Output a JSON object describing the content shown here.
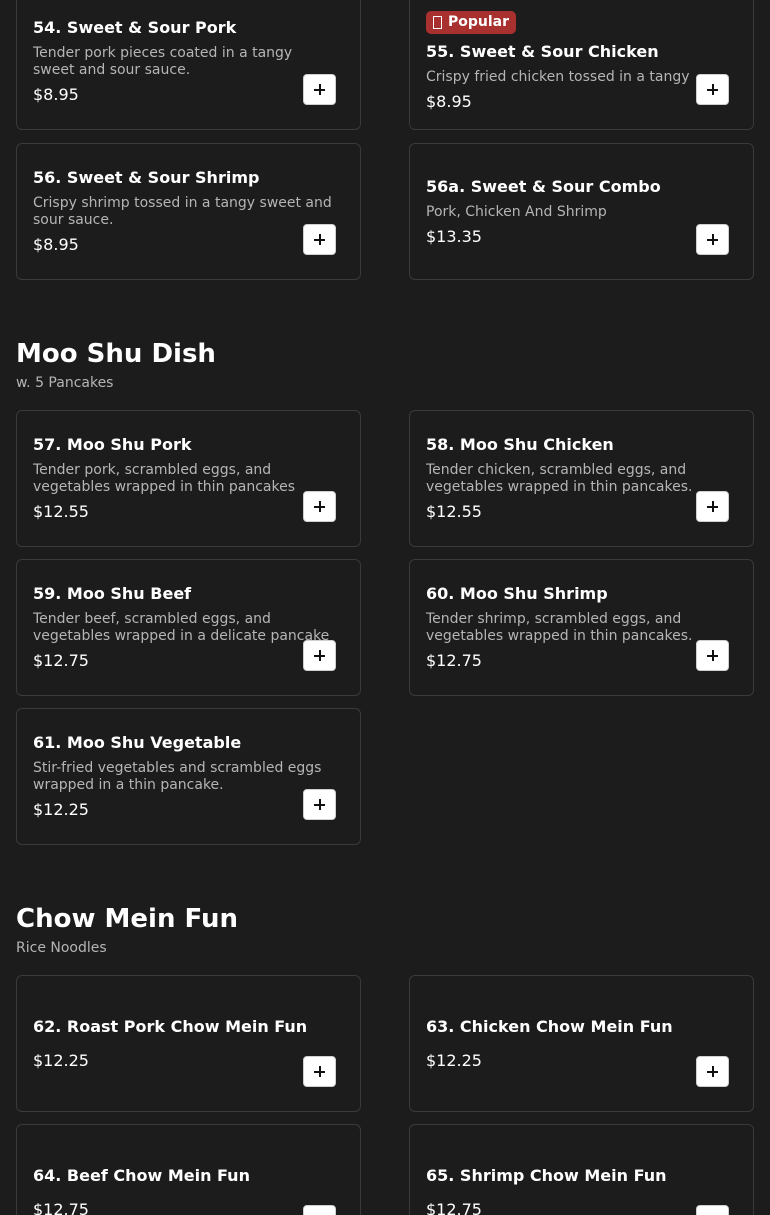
{
  "sweet_sour": {
    "items": [
      {
        "name": "54. Sweet & Sour Pork",
        "description": "Tender pork pieces coated in a tangy sweet and sour sauce.",
        "price": "$8.95"
      },
      {
        "badge": "Popular",
        "name": "55. Sweet & Sour Chicken",
        "description": "Crispy fried chicken tossed in a tangy sweet.",
        "price": "$8.95"
      },
      {
        "name": "56. Sweet & Sour Shrimp",
        "description": "Crispy shrimp tossed in a tangy sweet and sour sauce.",
        "price": "$8.95"
      },
      {
        "name": "56a. Sweet & Sour Combo",
        "description": "Pork, Chicken And Shrimp",
        "price": "$13.35"
      }
    ]
  },
  "moo_shu": {
    "title": "Moo Shu Dish",
    "subtitle": "w. 5 Pancakes",
    "items": [
      {
        "name": "57. Moo Shu Pork",
        "description": "Tender pork, scrambled eggs, and vegetables wrapped in thin pancakes",
        "price": "$12.55"
      },
      {
        "name": "58. Moo Shu Chicken",
        "description": "Tender chicken, scrambled eggs, and vegetables wrapped in thin pancakes.",
        "price": "$12.55"
      },
      {
        "name": "59. Moo Shu Beef",
        "description": "Tender beef, scrambled eggs, and vegetables wrapped in a delicate pancake",
        "price": "$12.75"
      },
      {
        "name": "60. Moo Shu Shrimp",
        "description": "Tender shrimp, scrambled eggs, and vegetables wrapped in thin pancakes.",
        "price": "$12.75"
      },
      {
        "name": "61. Moo Shu Vegetable",
        "description": "Stir-fried vegetables and scrambled eggs wrapped in a thin pancake.",
        "price": "$12.25"
      }
    ]
  },
  "chow_mein_fun": {
    "title": "Chow Mein Fun",
    "subtitle": "Rice Noodles",
    "items": [
      {
        "name": "62. Roast Pork Chow Mein Fun",
        "price": "$12.25"
      },
      {
        "name": "63. Chicken Chow Mein Fun",
        "price": "$12.25"
      },
      {
        "name": "64. Beef Chow Mein Fun",
        "price": "$12.75"
      },
      {
        "name": "65. Shrimp Chow Mein Fun",
        "price": "$12.75"
      }
    ]
  }
}
